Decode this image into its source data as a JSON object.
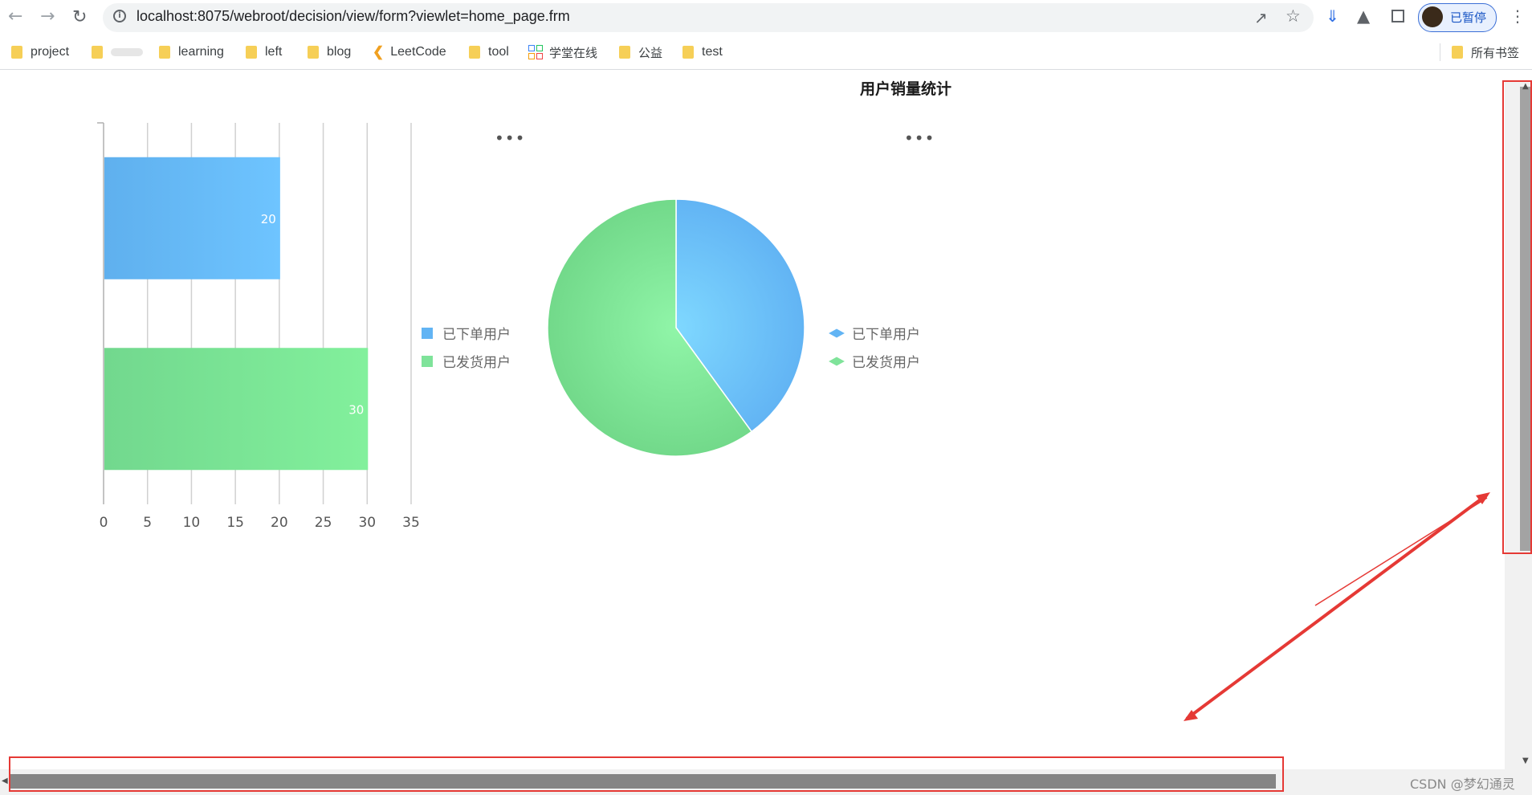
{
  "browser": {
    "url_host": "localhost",
    "url_rest": ":8075/webroot/decision/view/form?viewlet=home_page.frm",
    "profile_label": "已暂停"
  },
  "bookmarks": {
    "items": [
      {
        "label": "project",
        "icon": "folder-icon"
      },
      {
        "label": "",
        "icon": "folder-icon"
      },
      {
        "label": "learning",
        "icon": "folder-icon"
      },
      {
        "label": "left",
        "icon": "folder-icon"
      },
      {
        "label": "blog",
        "icon": "folder-icon"
      },
      {
        "label": "LeetCode",
        "icon": "leetcode-icon"
      },
      {
        "label": "tool",
        "icon": "folder-icon"
      },
      {
        "label": "学堂在线",
        "icon": "xuetang-icon"
      },
      {
        "label": "公益",
        "icon": "folder-icon"
      },
      {
        "label": "test",
        "icon": "folder-icon"
      }
    ],
    "all_bookmarks": "所有书签"
  },
  "report": {
    "title": "用户销量统计",
    "more_label": "•••"
  },
  "colors": {
    "blue": "#62b4f4",
    "green": "#7fe39a",
    "annotation_red": "#e53935"
  },
  "chart_data": [
    {
      "type": "bar",
      "orientation": "horizontal",
      "categories": [
        "已下单用户",
        "已发货用户"
      ],
      "values": [
        20,
        30
      ],
      "data_labels": [
        "20",
        "30"
      ],
      "xlim": [
        0,
        35
      ],
      "x_ticks": [
        "0",
        "5",
        "10",
        "15",
        "20",
        "25",
        "30",
        "35"
      ],
      "legend": [
        "已下单用户",
        "已发货用户"
      ],
      "grid": true,
      "legend_position": "right"
    },
    {
      "type": "pie",
      "categories": [
        "已下单用户",
        "已发货用户"
      ],
      "values": [
        20,
        30
      ],
      "legend": [
        "已下单用户",
        "已发货用户"
      ],
      "legend_position": "right"
    }
  ],
  "watermark": "CSDN @梦幻通灵"
}
